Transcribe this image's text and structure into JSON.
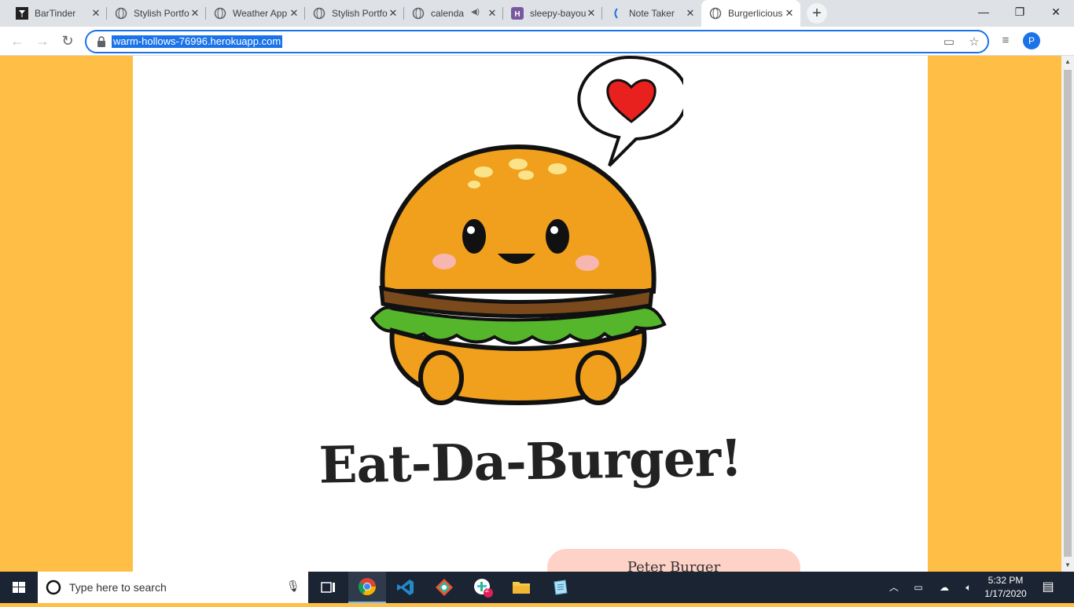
{
  "browser": {
    "tabs": [
      {
        "title": "BarTinder",
        "icon": "cocktail-icon"
      },
      {
        "title": "Stylish Portfo",
        "icon": "globe-icon"
      },
      {
        "title": "Weather App",
        "icon": "globe-icon"
      },
      {
        "title": "Stylish Portfo",
        "icon": "globe-icon"
      },
      {
        "title": "calenda",
        "icon": "globe-icon",
        "audio": true
      },
      {
        "title": "sleepy-bayou",
        "icon": "heroku-icon"
      },
      {
        "title": "Note Taker",
        "icon": "note-icon"
      },
      {
        "title": "Burgerlicious",
        "icon": "globe-icon",
        "active": true
      }
    ],
    "url": "warm-hollows-76996.herokuapp.com",
    "profile_initial": "P"
  },
  "page": {
    "headline": "Eat-Da-Burger!",
    "burger_items": [
      "Peter Burger"
    ],
    "colors": {
      "background": "#ffbf47",
      "panel": "#ffffff",
      "item_pill": "#ffd2c7"
    }
  },
  "taskbar": {
    "search_placeholder": "Type here to search",
    "time": "5:32 PM",
    "date": "1/17/2020",
    "slack_badge": "2"
  }
}
